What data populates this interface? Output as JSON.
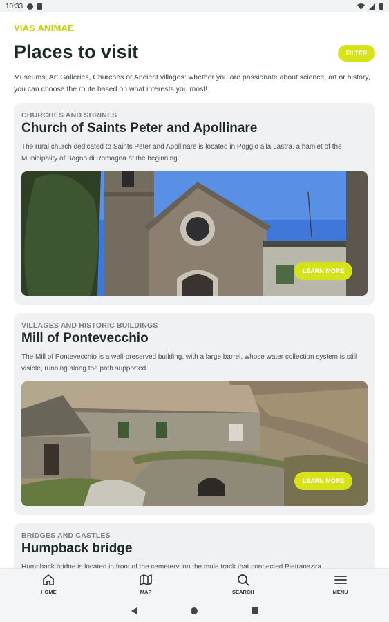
{
  "status_bar": {
    "time": "10:33"
  },
  "app": {
    "brand": "VIAS ANIMAE",
    "title": "Places to visit",
    "filter_label": "FILTER"
  },
  "intro": "Museums, Art Galleries, Churches or Ancient villages: whether you are passionate about science, art or history, you can choose the route based on what interests you most!",
  "cards": [
    {
      "category": "CHURCHES AND SHRINES",
      "title": "Church of Saints Peter and Apollinare",
      "description": "The rural church dedicated to Saints Peter and Apollinare is located in Poggio alla Lastra, a hamlet of the Municipality of Bagno di Romagna at the beginning...",
      "button": "LEARN MORE"
    },
    {
      "category": "VILLAGES AND HISTORIC BUILDINGS",
      "title": "Mill of Pontevecchio",
      "description": "The Mill of Pontevecchio is a well-preserved building, with a large barrel, whose water collection system is still visible, running along the path supported...",
      "button": "LEARN MORE"
    },
    {
      "category": "BRIDGES AND CASTLES",
      "title": "Humpback bridge",
      "description": "Humpback bridge is located in front of the cemetery, on the mule track that connected Pietrapazza"
    }
  ],
  "bottom_nav": [
    {
      "label": "HOME",
      "icon": "home-icon"
    },
    {
      "label": "MAP",
      "icon": "map-icon"
    },
    {
      "label": "SEARCH",
      "icon": "search-icon"
    },
    {
      "label": "MENU",
      "icon": "menu-icon"
    }
  ],
  "colors": {
    "accent": "#d7e31a",
    "brand": "#c6d200",
    "card_bg": "#f0f1f3"
  }
}
